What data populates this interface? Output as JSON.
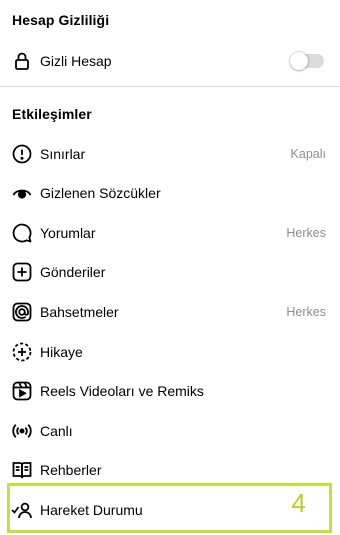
{
  "privacy_section": {
    "title": "Hesap Gizliliği",
    "private_account": {
      "label": "Gizli Hesap",
      "icon": "lock-icon",
      "toggle_on": false
    }
  },
  "interactions_section": {
    "title": "Etkileşimler",
    "items": [
      {
        "label": "Sınırlar",
        "value": "Kapalı",
        "icon": "limits-icon"
      },
      {
        "label": "Gizlenen Sözcükler",
        "value": "",
        "icon": "hidden-words-icon"
      },
      {
        "label": "Yorumlar",
        "value": "Herkes",
        "icon": "comment-icon"
      },
      {
        "label": "Gönderiler",
        "value": "",
        "icon": "posts-icon"
      },
      {
        "label": "Bahsetmeler",
        "value": "Herkes",
        "icon": "mention-icon"
      },
      {
        "label": "Hikaye",
        "value": "",
        "icon": "story-icon"
      },
      {
        "label": "Reels Videoları ve Remiks",
        "value": "",
        "icon": "reels-icon"
      },
      {
        "label": "Canlı",
        "value": "",
        "icon": "live-icon"
      },
      {
        "label": "Rehberler",
        "value": "",
        "icon": "guides-icon"
      },
      {
        "label": "Hareket Durumu",
        "value": "",
        "icon": "activity-status-icon"
      }
    ]
  },
  "annotation": {
    "step_number": "4",
    "highlight_color": "#c6e03a"
  },
  "colors": {
    "text": "#000000",
    "secondary_text": "#8e8e8e",
    "divider": "#dbdbdb"
  }
}
